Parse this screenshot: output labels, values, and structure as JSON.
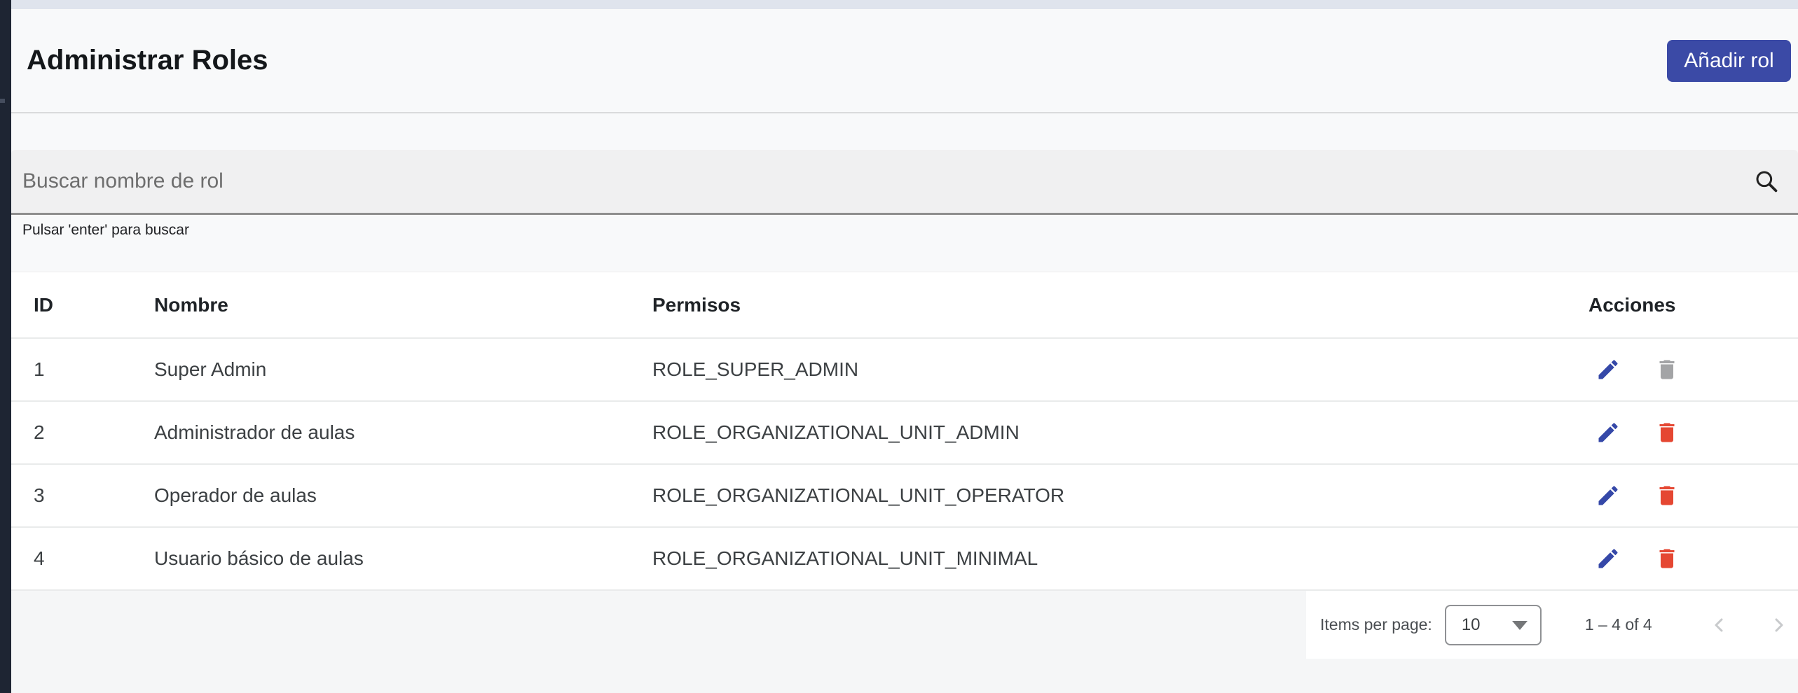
{
  "header": {
    "title": "Administrar Roles",
    "add_button_label": "Añadir rol"
  },
  "search": {
    "placeholder": "Buscar nombre de rol",
    "value": "",
    "helper": "Pulsar 'enter' para buscar",
    "icon": "search-icon"
  },
  "table": {
    "columns": [
      "ID",
      "Nombre",
      "Permisos",
      "Acciones"
    ],
    "rows": [
      {
        "id": "1",
        "nombre": "Super Admin",
        "permisos": "ROLE_SUPER_ADMIN",
        "delete_disabled": true
      },
      {
        "id": "2",
        "nombre": "Administrador de aulas",
        "permisos": "ROLE_ORGANIZATIONAL_UNIT_ADMIN",
        "delete_disabled": false
      },
      {
        "id": "3",
        "nombre": "Operador de aulas",
        "permisos": "ROLE_ORGANIZATIONAL_UNIT_OPERATOR",
        "delete_disabled": false
      },
      {
        "id": "4",
        "nombre": "Usuario básico de aulas",
        "permisos": "ROLE_ORGANIZATIONAL_UNIT_MINIMAL",
        "delete_disabled": false
      }
    ],
    "row_icons": {
      "edit": "edit-pencil-icon",
      "delete": "delete-trash-icon"
    }
  },
  "paginator": {
    "items_per_page_label": "Items per page:",
    "page_size": "10",
    "range_label": "1 – 4 of 4"
  },
  "colors": {
    "accent": "#3b4aa6",
    "accent-icon": "#3548a8",
    "warn": "#e54732",
    "disabled-icon": "#a3a4a6",
    "sidebar": "#1e2533",
    "topbar": "#dfe4ed",
    "page-bg": "#f8f9fa"
  }
}
